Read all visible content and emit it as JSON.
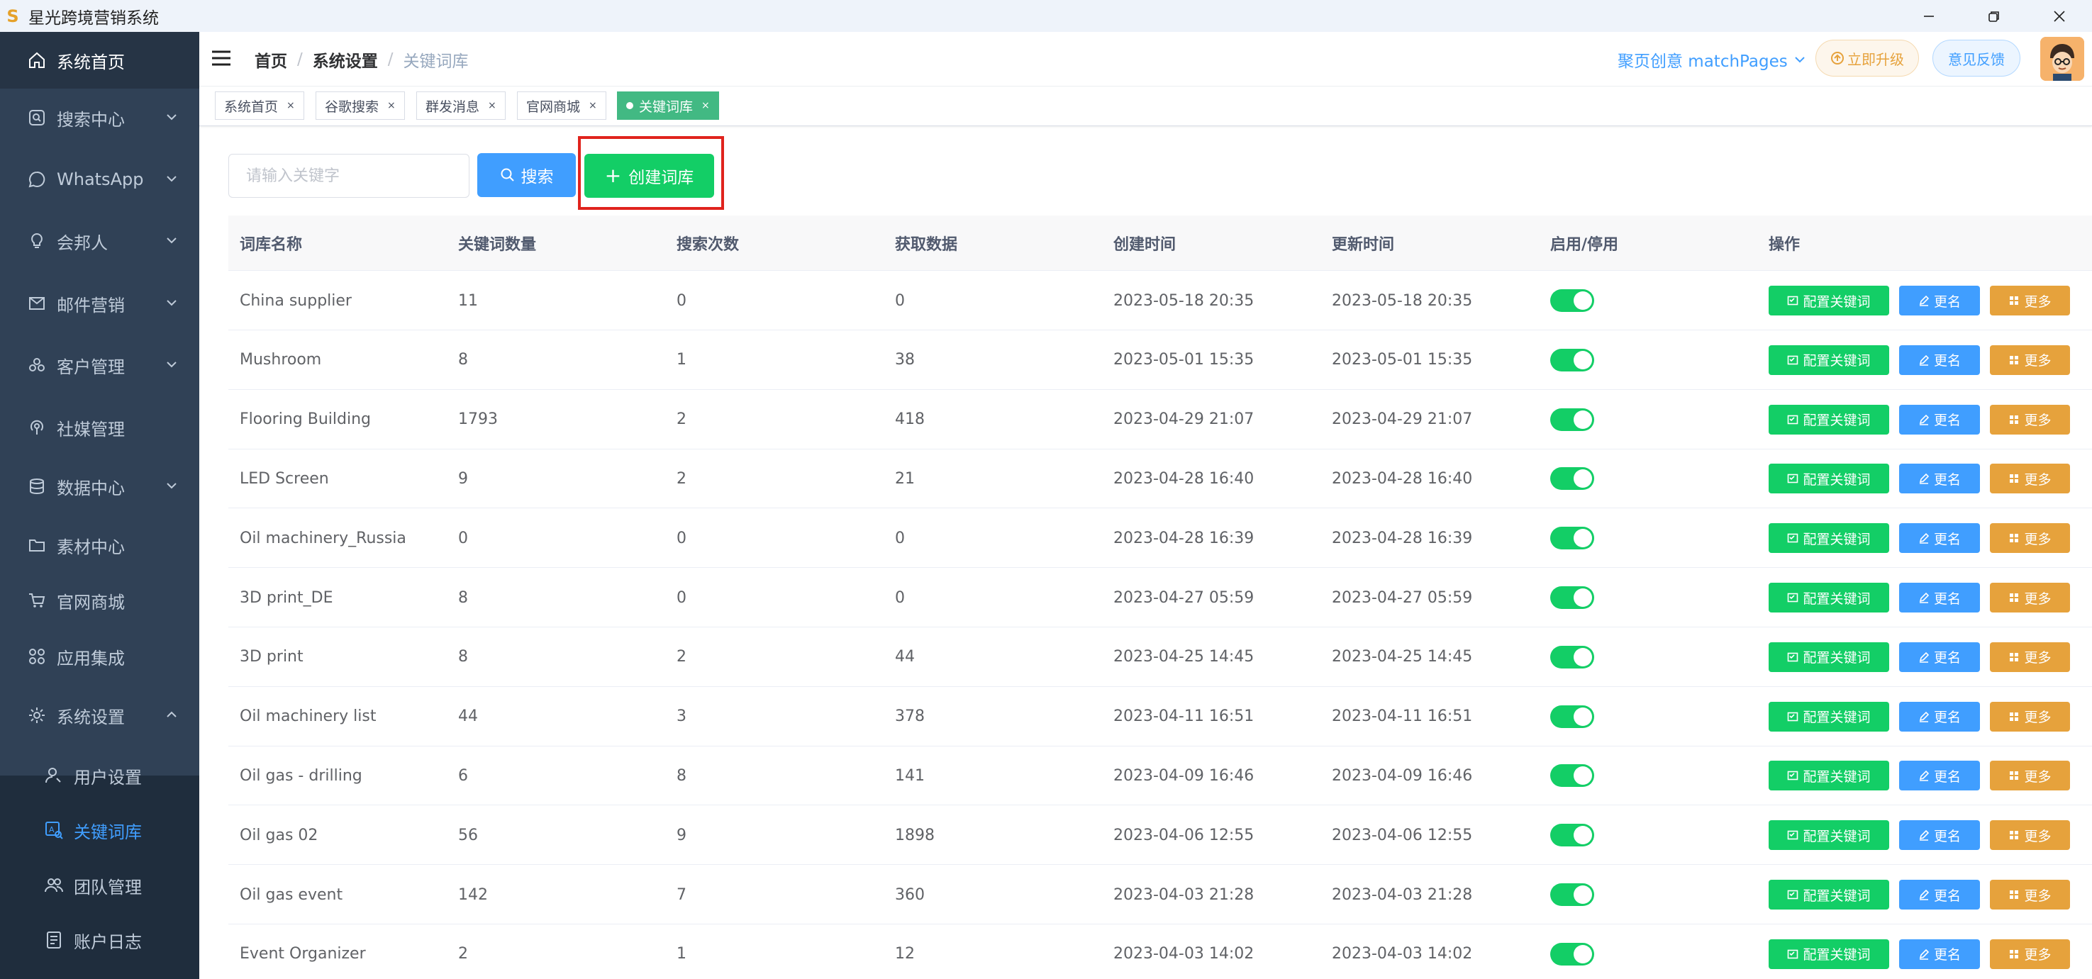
{
  "window": {
    "title": "星光跨境营销系统",
    "logo_text": "S"
  },
  "sidebar": {
    "items": [
      {
        "label": "系统首页",
        "icon": "home-icon"
      },
      {
        "label": "搜索中心",
        "icon": "search-box-icon"
      },
      {
        "label": "WhatsApp",
        "icon": "whatsapp-icon"
      },
      {
        "label": "会邦人",
        "icon": "lightbulb-icon"
      },
      {
        "label": "邮件营销",
        "icon": "mail-send-icon"
      },
      {
        "label": "客户管理",
        "icon": "users-group-icon"
      },
      {
        "label": "社媒管理",
        "icon": "broadcast-icon"
      },
      {
        "label": "数据中心",
        "icon": "database-icon"
      },
      {
        "label": "素材中心",
        "icon": "folder-icon"
      },
      {
        "label": "官网商城",
        "icon": "cart-icon"
      },
      {
        "label": "应用集成",
        "icon": "apps-grid-icon"
      },
      {
        "label": "系统设置",
        "icon": "gear-icon"
      }
    ],
    "sub_items": [
      {
        "label": "用户设置",
        "icon": "user-settings-icon"
      },
      {
        "label": "关键词库",
        "icon": "keyword-icon"
      },
      {
        "label": "团队管理",
        "icon": "team-icon"
      },
      {
        "label": "账户日志",
        "icon": "log-icon"
      }
    ]
  },
  "navbar": {
    "breadcrumb": [
      "首页",
      "系统设置",
      "关键词库"
    ],
    "brand_select": "聚页创意 matchPages",
    "upgrade_label": "立即升级",
    "feedback_label": "意见反馈"
  },
  "tags": [
    {
      "label": "系统首页"
    },
    {
      "label": "谷歌搜索"
    },
    {
      "label": "群发消息"
    },
    {
      "label": "官网商城"
    },
    {
      "label": "关键词库"
    }
  ],
  "toolbar": {
    "search_placeholder": "请输入关键字",
    "search_label": "搜索",
    "create_label": "创建词库"
  },
  "table": {
    "columns": [
      "词库名称",
      "关键词数量",
      "搜索次数",
      "获取数据",
      "创建时间",
      "更新时间",
      "启用/停用",
      "操作"
    ],
    "action_labels": {
      "config": "配置关键词",
      "rename": "更名",
      "more": "更多"
    },
    "rows": [
      {
        "name": "China supplier",
        "keywords": "11",
        "searches": "0",
        "data": "0",
        "created": "2023-05-18 20:35",
        "updated": "2023-05-18 20:35",
        "enabled": true
      },
      {
        "name": "Mushroom",
        "keywords": "8",
        "searches": "1",
        "data": "38",
        "created": "2023-05-01 15:35",
        "updated": "2023-05-01 15:35",
        "enabled": true
      },
      {
        "name": "Flooring Building",
        "keywords": "1793",
        "searches": "2",
        "data": "418",
        "created": "2023-04-29 21:07",
        "updated": "2023-04-29 21:07",
        "enabled": true
      },
      {
        "name": "LED Screen",
        "keywords": "9",
        "searches": "2",
        "data": "21",
        "created": "2023-04-28 16:40",
        "updated": "2023-04-28 16:40",
        "enabled": true
      },
      {
        "name": "Oil machinery_Russia",
        "keywords": "0",
        "searches": "0",
        "data": "0",
        "created": "2023-04-28 16:39",
        "updated": "2023-04-28 16:39",
        "enabled": true
      },
      {
        "name": "3D print_DE",
        "keywords": "8",
        "searches": "0",
        "data": "0",
        "created": "2023-04-27 05:59",
        "updated": "2023-04-27 05:59",
        "enabled": true
      },
      {
        "name": "3D print",
        "keywords": "8",
        "searches": "2",
        "data": "44",
        "created": "2023-04-25 14:45",
        "updated": "2023-04-25 14:45",
        "enabled": true
      },
      {
        "name": "Oil machinery list",
        "keywords": "44",
        "searches": "3",
        "data": "378",
        "created": "2023-04-11 16:51",
        "updated": "2023-04-11 16:51",
        "enabled": true
      },
      {
        "name": "Oil gas - drilling",
        "keywords": "6",
        "searches": "8",
        "data": "141",
        "created": "2023-04-09 16:46",
        "updated": "2023-04-09 16:46",
        "enabled": true
      },
      {
        "name": "Oil gas 02",
        "keywords": "56",
        "searches": "9",
        "data": "1898",
        "created": "2023-04-06 12:55",
        "updated": "2023-04-06 12:55",
        "enabled": true
      },
      {
        "name": "Oil gas event",
        "keywords": "142",
        "searches": "7",
        "data": "360",
        "created": "2023-04-03 21:28",
        "updated": "2023-04-03 21:28",
        "enabled": true
      },
      {
        "name": "Event Organizer",
        "keywords": "2",
        "searches": "1",
        "data": "12",
        "created": "2023-04-03 14:02",
        "updated": "2023-04-03 14:02",
        "enabled": true
      }
    ]
  },
  "colors": {
    "sidebar_bg": "#304156",
    "primary": "#409eff",
    "success": "#13ce66",
    "warning": "#e6a23c",
    "tag_active": "#42b983",
    "highlight": "#e0231d"
  }
}
